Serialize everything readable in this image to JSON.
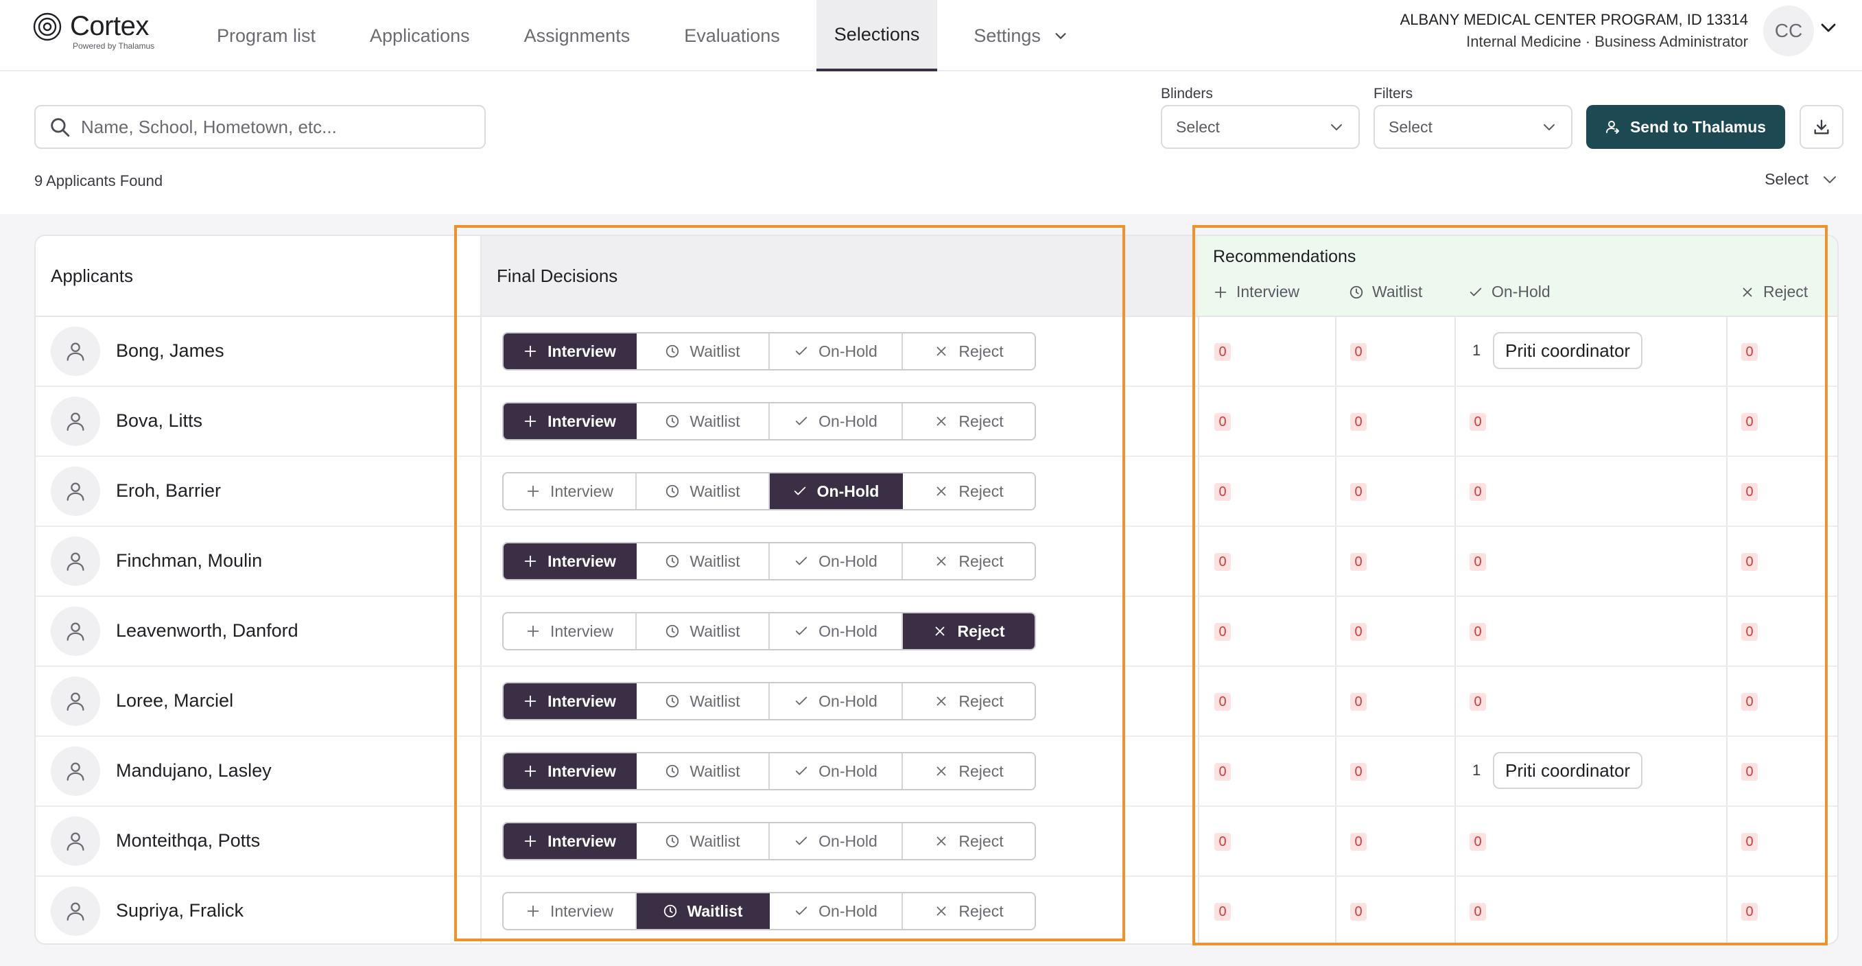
{
  "header": {
    "brand": "Cortex",
    "brand_sub": "Powered by Thalamus",
    "nav": [
      "Program list",
      "Applications",
      "Assignments",
      "Evaluations",
      "Selections",
      "Settings"
    ],
    "active_nav": "Selections",
    "program_line1": "ALBANY MEDICAL CENTER PROGRAM, ID 13314",
    "program_line2": "Internal Medicine · Business Administrator",
    "avatar_initials": "CC"
  },
  "toolbar": {
    "search_placeholder": "Name, School, Hometown, etc...",
    "blinders_label": "Blinders",
    "blinders_value": "Select",
    "filters_label": "Filters",
    "filters_value": "Select",
    "send_label": "Send to Thalamus",
    "count_text": "9 Applicants Found",
    "sort_value": "Select"
  },
  "table": {
    "applicants_header": "Applicants",
    "final_header": "Final Decisions",
    "rec_header": "Recommendations",
    "rec_columns": [
      "Interview",
      "Waitlist",
      "On-Hold",
      "Reject"
    ],
    "decision_options": [
      "Interview",
      "Waitlist",
      "On-Hold",
      "Reject"
    ],
    "rows": [
      {
        "name": "Bong, James",
        "decision": "Interview",
        "rec": [
          "0",
          "0",
          "1",
          "0"
        ],
        "onhold_chip": "Priti coordinator"
      },
      {
        "name": "Bova, Litts",
        "decision": "Interview",
        "rec": [
          "0",
          "0",
          "0",
          "0"
        ],
        "onhold_chip": ""
      },
      {
        "name": "Eroh, Barrier",
        "decision": "On-Hold",
        "rec": [
          "0",
          "0",
          "0",
          "0"
        ],
        "onhold_chip": ""
      },
      {
        "name": "Finchman, Moulin",
        "decision": "Interview",
        "rec": [
          "0",
          "0",
          "0",
          "0"
        ],
        "onhold_chip": ""
      },
      {
        "name": "Leavenworth, Danford",
        "decision": "Reject",
        "rec": [
          "0",
          "0",
          "0",
          "0"
        ],
        "onhold_chip": ""
      },
      {
        "name": "Loree, Marciel",
        "decision": "Interview",
        "rec": [
          "0",
          "0",
          "0",
          "0"
        ],
        "onhold_chip": ""
      },
      {
        "name": "Mandujano, Lasley",
        "decision": "Interview",
        "rec": [
          "0",
          "0",
          "1",
          "0"
        ],
        "onhold_chip": "Priti coordinator"
      },
      {
        "name": "Monteithqa, Potts",
        "decision": "Interview",
        "rec": [
          "0",
          "0",
          "0",
          "0"
        ],
        "onhold_chip": ""
      },
      {
        "name": "Supriya, Fralick",
        "decision": "Waitlist",
        "rec": [
          "0",
          "0",
          "0",
          "0"
        ],
        "onhold_chip": ""
      }
    ]
  },
  "colors": {
    "accent_dark": "#3a2f45",
    "send_button": "#1d4a52",
    "highlight": "#f0922b",
    "badge_bg": "#fde2e2",
    "badge_text": "#d33a3a",
    "rec_header_bg": "#edf8ee"
  },
  "icons": {
    "Interview": "plus-icon",
    "Waitlist": "clock-icon",
    "On-Hold": "check-icon",
    "Reject": "x-icon"
  }
}
